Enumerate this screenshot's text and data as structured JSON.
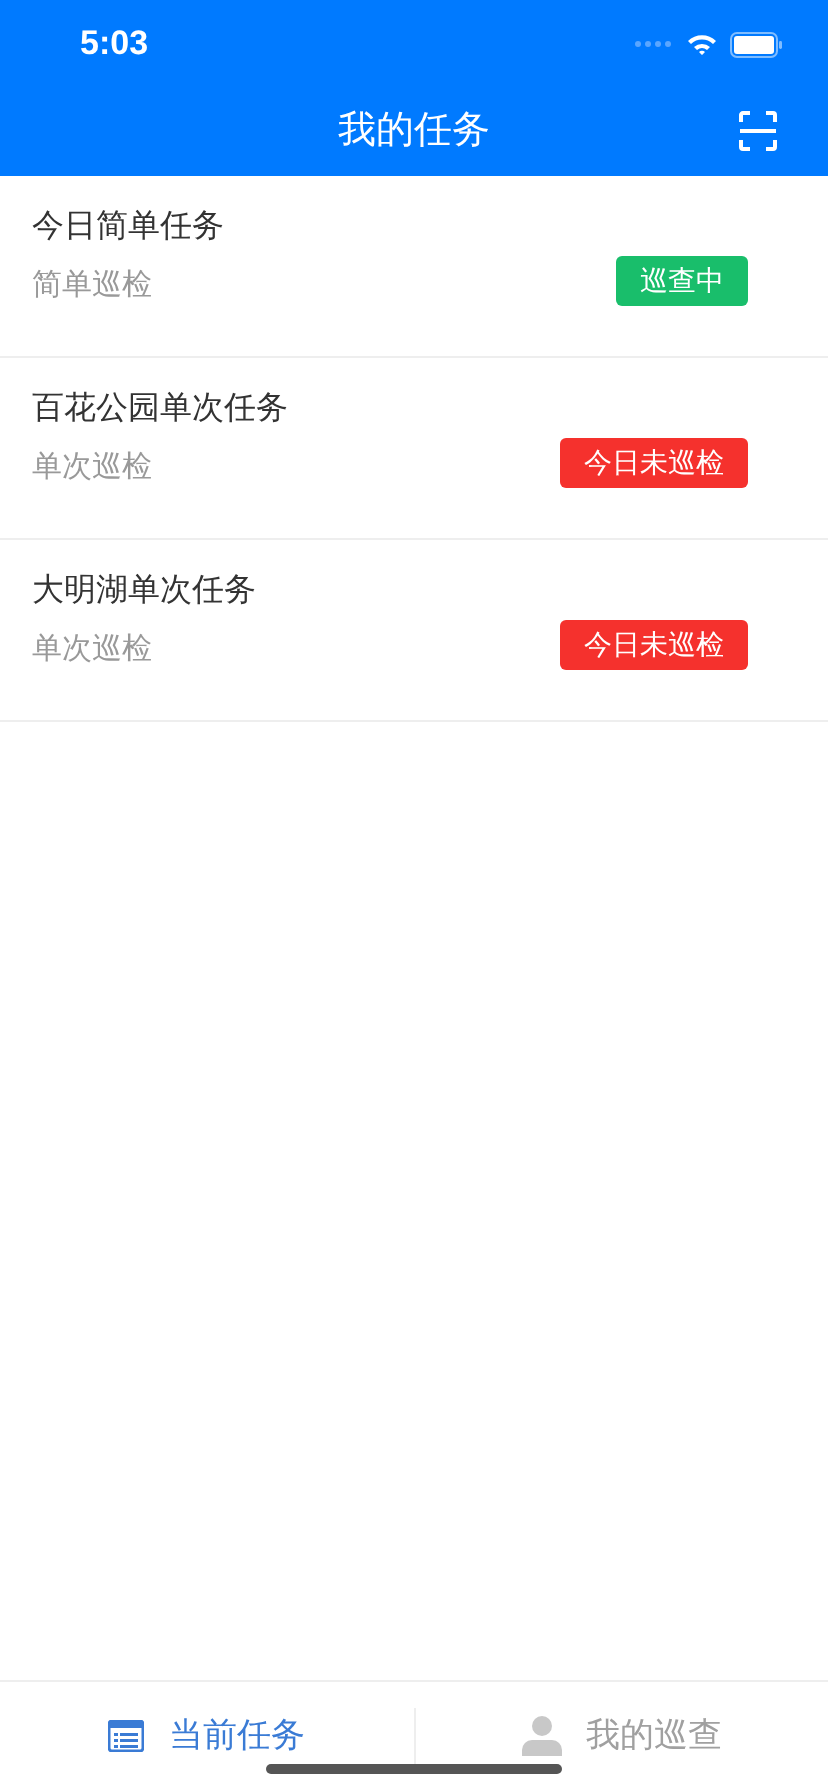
{
  "status_bar": {
    "time": "5:03"
  },
  "header": {
    "title": "我的任务"
  },
  "tasks": [
    {
      "name": "今日简单任务",
      "type": "简单巡检",
      "status": {
        "label": "巡查中",
        "color": "#19be6b"
      }
    },
    {
      "name": "百花公园单次任务",
      "type": "单次巡检",
      "status": {
        "label": "今日未巡检",
        "color": "#f5312d"
      }
    },
    {
      "name": "大明湖单次任务",
      "type": "单次巡检",
      "status": {
        "label": "今日未巡检",
        "color": "#f5312d"
      }
    }
  ],
  "tab_bar": [
    {
      "label": "当前任务",
      "kind": "list",
      "selected": true
    },
    {
      "label": "我的巡查",
      "kind": "person",
      "selected": false
    }
  ]
}
